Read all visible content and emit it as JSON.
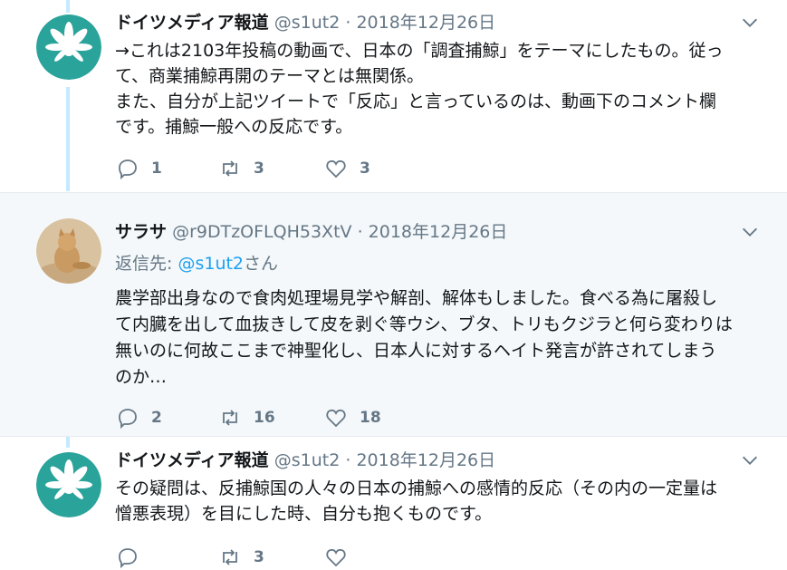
{
  "tweets": [
    {
      "name": "ドイツメディア報道",
      "handle": "@s1ut2",
      "dot": "·",
      "date": "2018年12月26日",
      "lines": [
        "→これは2103年投稿の動画で、日本の「調査捕鯨」をテーマにしたもの。従っ",
        "て、商業捕鯨再開のテーマとは無関係。",
        "また、自分が上記ツイートで「反応」と言っているのは、動画下のコメント欄",
        "です。捕鯨一般への反応です。"
      ],
      "replies": "1",
      "retweets": "3",
      "likes": "3"
    },
    {
      "name": "サラサ",
      "handle": "@r9DTzOFLQH53XtV",
      "dot": "·",
      "date": "2018年12月26日",
      "reply_prefix": "返信先: ",
      "reply_mention": "@s1ut2",
      "reply_suffix": "さん",
      "lines": [
        "農学部出身なので食肉処理場見学や解剖、解体もしました。食べる為に屠殺し",
        "て内臓を出して血抜きして皮を剥ぐ等ウシ、ブタ、トリもクジラと何ら変わりは",
        "無いのに何故ここまで神聖化し、日本人に対するヘイト発言が許されてしまう",
        "のか…"
      ],
      "replies": "2",
      "retweets": "16",
      "likes": "18"
    },
    {
      "name": "ドイツメディア報道",
      "handle": "@s1ut2",
      "dot": "·",
      "date": "2018年12月26日",
      "lines": [
        "その疑問は、反捕鯨国の人々の日本の捕鯨への感情的反応（その内の一定量は",
        "憎悪表現）を目にした時、自分も抱くものです。"
      ],
      "replies": "",
      "retweets": "3",
      "likes": ""
    }
  ],
  "colors": {
    "accent": "#1da1f2",
    "secondary_text": "#657786",
    "thread_line": "#c4eaff",
    "avatar_brand": "#2aa39a"
  },
  "icons": [
    "reply-icon",
    "retweet-icon",
    "like-icon",
    "chevron-down-icon"
  ]
}
